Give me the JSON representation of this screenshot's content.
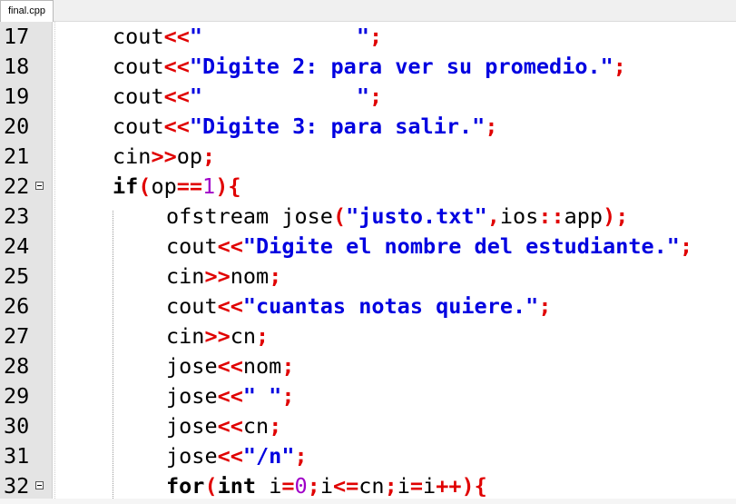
{
  "tab": {
    "label": "final.cpp"
  },
  "colors": {
    "keyword": "#000000",
    "operator": "#e00000",
    "string": "#0000e0",
    "number": "#a000c8",
    "gutter": "#e4e4e4"
  },
  "lines": [
    {
      "num": "17",
      "fold": false,
      "indent": 1,
      "tokens": [
        [
          "t",
          "cout"
        ],
        [
          "o",
          "<<"
        ],
        [
          "s",
          "\"            \""
        ],
        [
          "o",
          ";"
        ]
      ]
    },
    {
      "num": "18",
      "fold": false,
      "indent": 1,
      "tokens": [
        [
          "t",
          "cout"
        ],
        [
          "o",
          "<<"
        ],
        [
          "s",
          "\"Digite 2: para ver su promedio.\""
        ],
        [
          "o",
          ";"
        ]
      ]
    },
    {
      "num": "19",
      "fold": false,
      "indent": 1,
      "tokens": [
        [
          "t",
          "cout"
        ],
        [
          "o",
          "<<"
        ],
        [
          "s",
          "\"            \""
        ],
        [
          "o",
          ";"
        ]
      ]
    },
    {
      "num": "20",
      "fold": false,
      "indent": 1,
      "tokens": [
        [
          "t",
          "cout"
        ],
        [
          "o",
          "<<"
        ],
        [
          "s",
          "\"Digite 3: para salir.\""
        ],
        [
          "o",
          ";"
        ]
      ]
    },
    {
      "num": "21",
      "fold": false,
      "indent": 1,
      "tokens": [
        [
          "t",
          "cin"
        ],
        [
          "o",
          ">>"
        ],
        [
          "t",
          "op"
        ],
        [
          "o",
          ";"
        ]
      ]
    },
    {
      "num": "22",
      "fold": true,
      "indent": 1,
      "tokens": [
        [
          "k",
          "if"
        ],
        [
          "o",
          "("
        ],
        [
          "t",
          "op"
        ],
        [
          "o",
          "=="
        ],
        [
          "n",
          "1"
        ],
        [
          "o",
          "){"
        ]
      ]
    },
    {
      "num": "23",
      "fold": false,
      "indent": 2,
      "tokens": [
        [
          "t",
          "ofstream jose"
        ],
        [
          "o",
          "("
        ],
        [
          "s",
          "\"justo.txt\""
        ],
        [
          "o",
          ","
        ],
        [
          "t",
          "ios"
        ],
        [
          "o",
          "::"
        ],
        [
          "t",
          "app"
        ],
        [
          "o",
          ");"
        ]
      ]
    },
    {
      "num": "24",
      "fold": false,
      "indent": 2,
      "tokens": [
        [
          "t",
          "cout"
        ],
        [
          "o",
          "<<"
        ],
        [
          "s",
          "\"Digite el nombre del estudiante.\""
        ],
        [
          "o",
          ";"
        ]
      ]
    },
    {
      "num": "25",
      "fold": false,
      "indent": 2,
      "tokens": [
        [
          "t",
          "cin"
        ],
        [
          "o",
          ">>"
        ],
        [
          "t",
          "nom"
        ],
        [
          "o",
          ";"
        ]
      ]
    },
    {
      "num": "26",
      "fold": false,
      "indent": 2,
      "tokens": [
        [
          "t",
          "cout"
        ],
        [
          "o",
          "<<"
        ],
        [
          "s",
          "\"cuantas notas quiere.\""
        ],
        [
          "o",
          ";"
        ]
      ]
    },
    {
      "num": "27",
      "fold": false,
      "indent": 2,
      "tokens": [
        [
          "t",
          "cin"
        ],
        [
          "o",
          ">>"
        ],
        [
          "t",
          "cn"
        ],
        [
          "o",
          ";"
        ]
      ]
    },
    {
      "num": "28",
      "fold": false,
      "indent": 2,
      "tokens": [
        [
          "t",
          "jose"
        ],
        [
          "o",
          "<<"
        ],
        [
          "t",
          "nom"
        ],
        [
          "o",
          ";"
        ]
      ]
    },
    {
      "num": "29",
      "fold": false,
      "indent": 2,
      "tokens": [
        [
          "t",
          "jose"
        ],
        [
          "o",
          "<<"
        ],
        [
          "s",
          "\" \""
        ],
        [
          "o",
          ";"
        ]
      ]
    },
    {
      "num": "30",
      "fold": false,
      "indent": 2,
      "tokens": [
        [
          "t",
          "jose"
        ],
        [
          "o",
          "<<"
        ],
        [
          "t",
          "cn"
        ],
        [
          "o",
          ";"
        ]
      ]
    },
    {
      "num": "31",
      "fold": false,
      "indent": 2,
      "tokens": [
        [
          "t",
          "jose"
        ],
        [
          "o",
          "<<"
        ],
        [
          "s",
          "\"/n\""
        ],
        [
          "o",
          ";"
        ]
      ]
    },
    {
      "num": "32",
      "fold": true,
      "indent": 2,
      "tokens": [
        [
          "k",
          "for"
        ],
        [
          "o",
          "("
        ],
        [
          "k",
          "int"
        ],
        [
          "t",
          " i"
        ],
        [
          "o",
          "="
        ],
        [
          "n",
          "0"
        ],
        [
          "o",
          ";"
        ],
        [
          "t",
          "i"
        ],
        [
          "o",
          "<="
        ],
        [
          "t",
          "cn"
        ],
        [
          "o",
          ";"
        ],
        [
          "t",
          "i"
        ],
        [
          "o",
          "="
        ],
        [
          "t",
          "i"
        ],
        [
          "o",
          "++){"
        ]
      ]
    }
  ]
}
